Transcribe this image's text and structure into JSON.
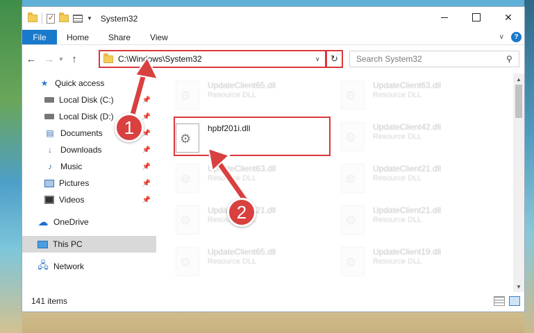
{
  "window": {
    "title": "System32"
  },
  "ribbon": {
    "tabs": [
      "File",
      "Home",
      "Share",
      "View"
    ],
    "help": "?"
  },
  "address": {
    "path": "C:\\Windows\\System32",
    "search_placeholder": "Search System32"
  },
  "sidebar": {
    "items": [
      {
        "label": "Quick access",
        "icon": "star-icon",
        "pinned": false
      },
      {
        "label": "Local Disk (C:)",
        "icon": "drive-icon",
        "pinned": true
      },
      {
        "label": "Local Disk (D:)",
        "icon": "drive-icon",
        "pinned": true
      },
      {
        "label": "Documents",
        "icon": "documents-icon",
        "pinned": true
      },
      {
        "label": "Downloads",
        "icon": "downloads-icon",
        "pinned": true
      },
      {
        "label": "Music",
        "icon": "music-icon",
        "pinned": true
      },
      {
        "label": "Pictures",
        "icon": "pictures-icon",
        "pinned": true
      },
      {
        "label": "Videos",
        "icon": "videos-icon",
        "pinned": true
      },
      {
        "label": "OneDrive",
        "icon": "onedrive-icon",
        "pinned": false
      },
      {
        "label": "This PC",
        "icon": "this-pc-icon",
        "pinned": false,
        "selected": true
      },
      {
        "label": "Network",
        "icon": "network-icon",
        "pinned": false
      }
    ]
  },
  "files": [
    {
      "name": "UpdateClient65.dll",
      "type": "Resource DLL"
    },
    {
      "name": "UpdateClient63.dll",
      "type": "Resource DLL"
    },
    {
      "name": "hpbf201i.dll",
      "type": ""
    },
    {
      "name": "UpdateClient42.dll",
      "type": "Resource DLL"
    },
    {
      "name": "UpdateClient63.dll",
      "type": "Resource DLL"
    },
    {
      "name": "UpdateClient21.dll",
      "type": "Resource DLL"
    },
    {
      "name": "UpdateClient21.dll",
      "type": "Resource DLL"
    },
    {
      "name": "UpdateClient21.dll",
      "type": "Resource DLL"
    },
    {
      "name": "UpdateClient65.dll",
      "type": "Resource DLL"
    },
    {
      "name": "UpdateClient19.dll",
      "type": "Resource DLL"
    }
  ],
  "status": {
    "item_count": "141 items"
  },
  "callouts": {
    "step1": "1",
    "step2": "2"
  },
  "colors": {
    "accent": "#1979ca",
    "highlight": "#d9373a",
    "selected_bg": "#d9d9d9"
  }
}
